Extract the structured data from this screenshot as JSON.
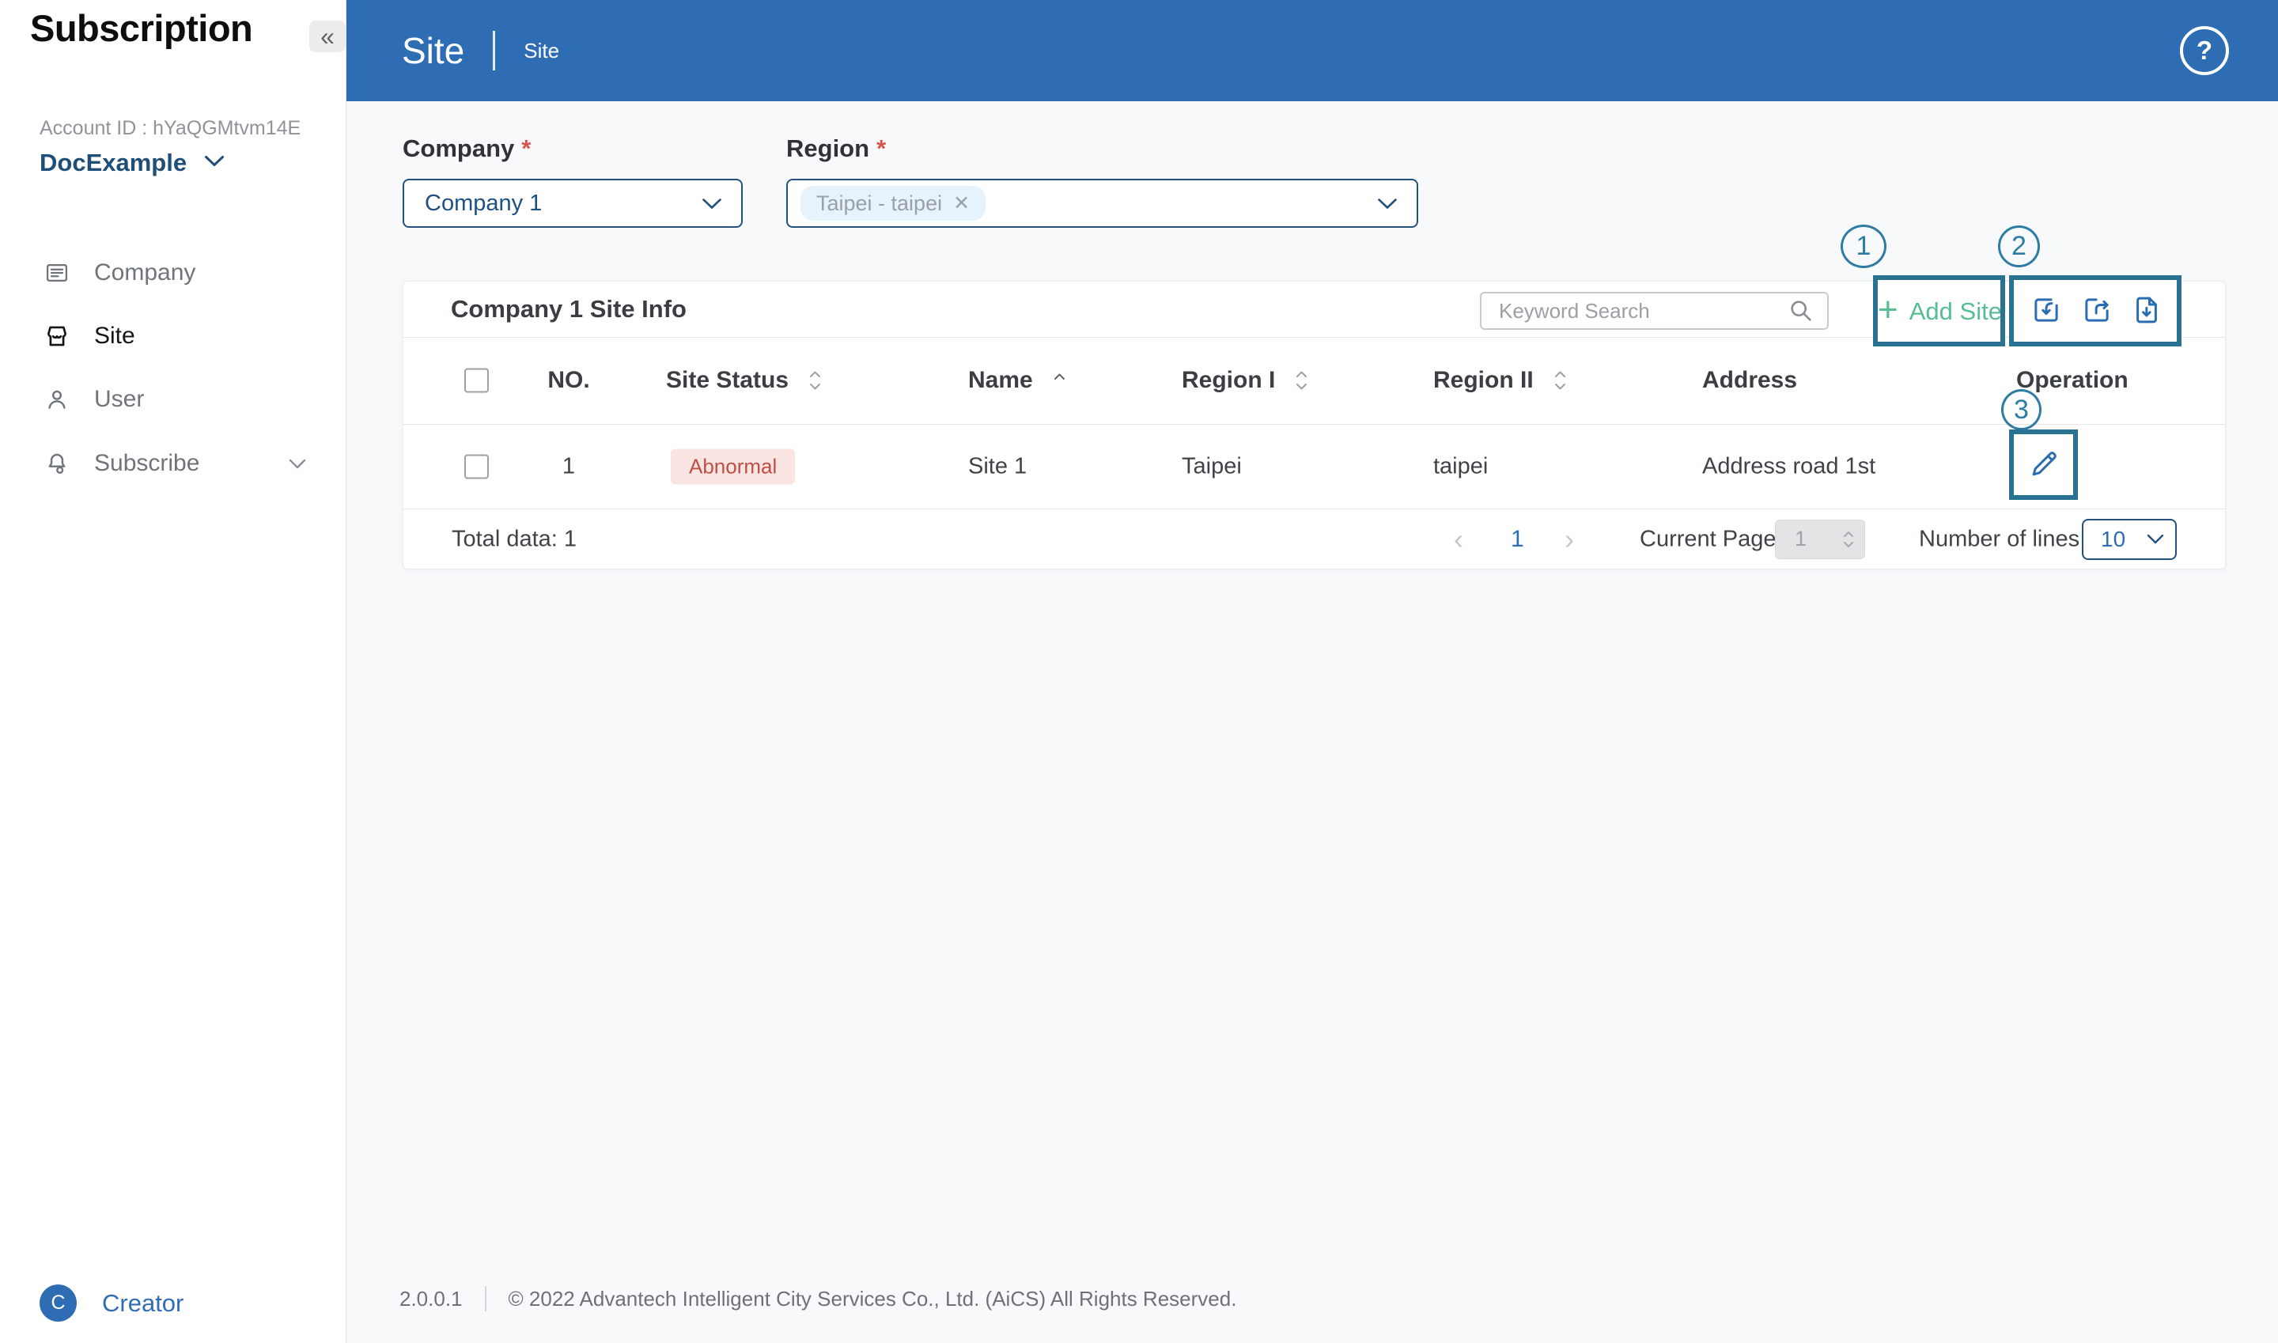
{
  "app": {
    "title": "Subscription",
    "version": "2.0.0.1",
    "copyright": "© 2022 Advantech Intelligent City Services Co., Ltd. (AiCS) All Rights Reserved."
  },
  "icons": {
    "collapse": "«",
    "help": "?",
    "plus": "+",
    "tag_close": "✕",
    "prev": "‹",
    "next": "›"
  },
  "sidebar": {
    "account_id": "Account ID : hYaQGMtvm14E",
    "account_name": "DocExample",
    "items": [
      "Company",
      "Site",
      "User",
      "Subscribe"
    ],
    "avatar_initial": "C",
    "footer_user": "Creator"
  },
  "header": {
    "title": "Site",
    "breadcrumb": "Site"
  },
  "filters": {
    "required_mark": "*",
    "company": {
      "label": "Company",
      "value": "Company 1"
    },
    "region": {
      "label": "Region",
      "tag": "Taipei - taipei"
    }
  },
  "card": {
    "title": "Company 1 Site Info",
    "search_placeholder": "Keyword Search",
    "add_site_label": "Add Site",
    "table": {
      "columns": [
        {
          "label": "NO.",
          "sort": "none"
        },
        {
          "label": "Site Status",
          "sort": "both"
        },
        {
          "label": "Name",
          "sort": "asc"
        },
        {
          "label": "Region I",
          "sort": "both"
        },
        {
          "label": "Region II",
          "sort": "both"
        },
        {
          "label": "Address",
          "sort": "none"
        },
        {
          "label": "Operation",
          "sort": "none"
        }
      ],
      "rows": [
        {
          "no": "1",
          "status": "Abnormal",
          "name": "Site 1",
          "region1": "Taipei",
          "region2": "taipei",
          "address": "Address road 1st"
        }
      ]
    },
    "pagination": {
      "total": "Total data: 1",
      "page": "1",
      "current_page_label": "Current Page",
      "current_page_value": "1",
      "lines_label": "Number of lines",
      "lines_value": "10"
    }
  },
  "annotations": [
    "1",
    "2",
    "3"
  ],
  "colors": {
    "header_blue": "#2e6db4",
    "accent_green": "#57bd92",
    "annotation_box": "#2a7291",
    "annotation_circle": "#2e7ca3",
    "navy_border": "#24517c",
    "link_blue": "#2f6eb5",
    "icon_blue": "#2a6cb0",
    "abnormal_text": "#bf4e43",
    "abnormal_bg": "#fbe5e3",
    "page_bg": "#f7f9fb"
  }
}
